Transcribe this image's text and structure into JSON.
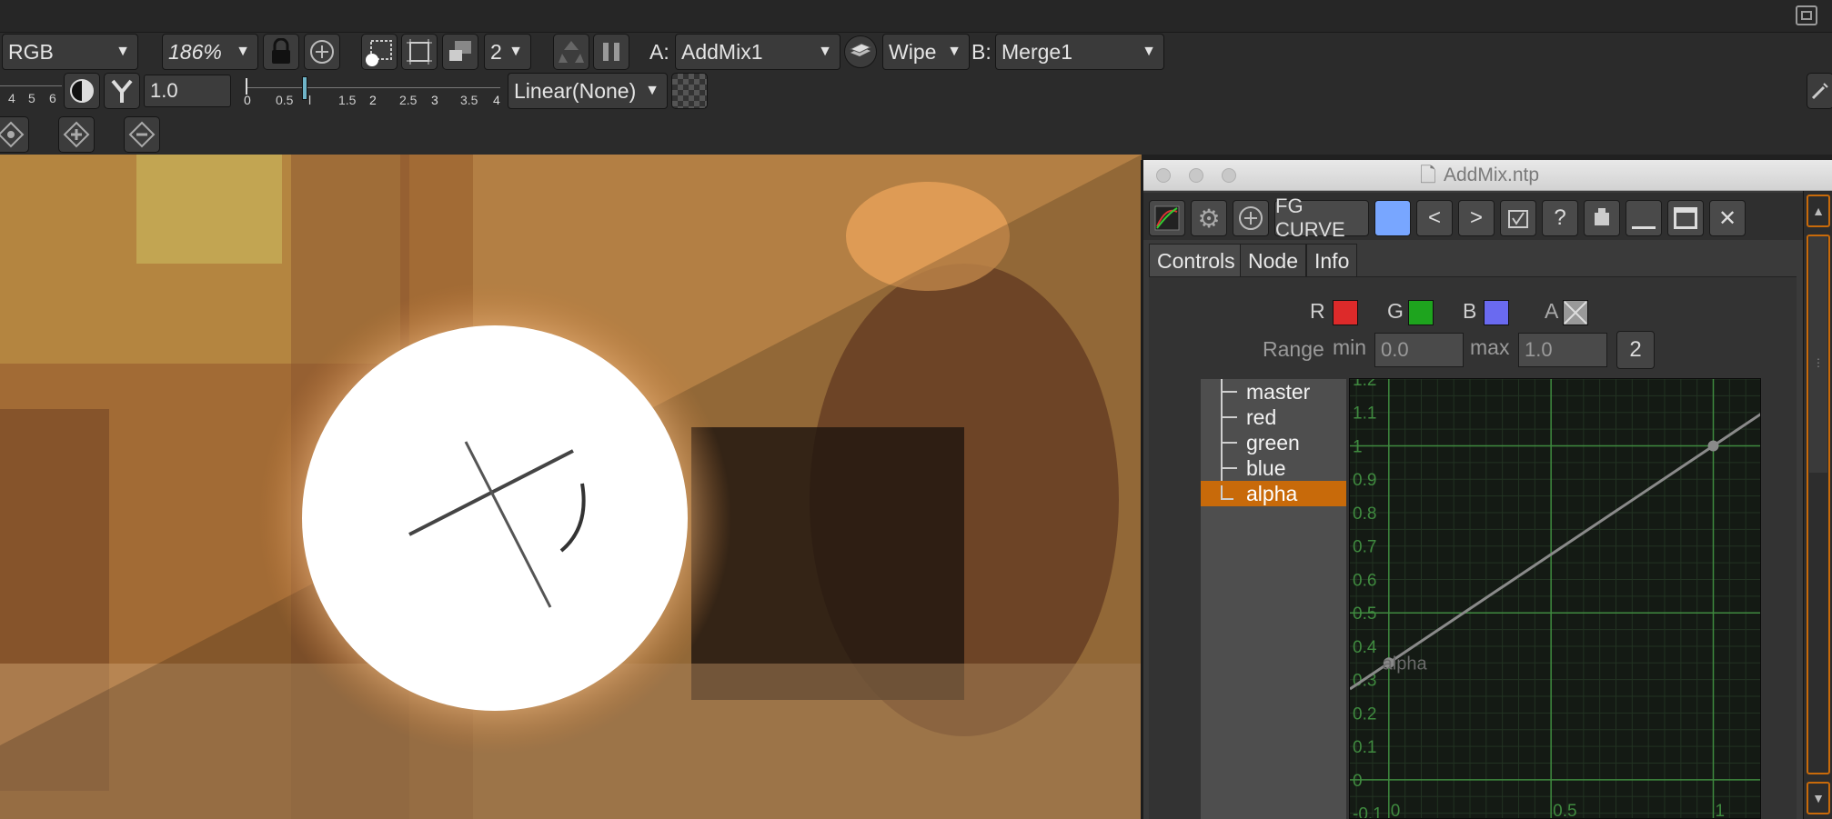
{
  "toolbar": {
    "channel": "RGB",
    "zoom": "186%",
    "downrez": "2",
    "a_label": "A:",
    "a_input": "AddMix1",
    "wipe_mode": "Wipe",
    "b_label": "B:",
    "b_input": "Merge1",
    "gain_value": "1.0",
    "colorspace": "Linear(None)",
    "fstops": [
      "4",
      "5",
      "6"
    ],
    "gamma_ticks": [
      "0",
      "0.5",
      "l",
      "1.5",
      "2",
      "2.5",
      "3",
      "3.5",
      "4"
    ]
  },
  "panel": {
    "title": "AddMix.ntp",
    "curve_name": "FG CURVE",
    "tabs": [
      "Controls",
      "Node",
      "Info"
    ],
    "channels": {
      "r": "R",
      "g": "G",
      "b": "B",
      "a": "A"
    },
    "range_label": "Range",
    "min_label": "min",
    "min_value": "0.0",
    "max_label": "max",
    "max_value": "1.0",
    "range_button": "2",
    "curve_list": [
      "master",
      "red",
      "green",
      "blue",
      "alpha"
    ],
    "selected_curve": "alpha"
  },
  "colors": {
    "red": "#dd2a2a",
    "green": "#1ea41e",
    "blue": "#6a6af0",
    "accent": "#c86a0a",
    "curve_swatch": "#78a6ff"
  },
  "chart_data": {
    "type": "line",
    "title": "",
    "xlabel": "",
    "ylabel": "",
    "series": [
      {
        "name": "alpha",
        "x": [
          0,
          1
        ],
        "y": [
          0.35,
          1.0
        ]
      }
    ],
    "xlim": [
      -0.12,
      1.15
    ],
    "ylim": [
      -0.12,
      1.2
    ],
    "x_ticks": [
      "0",
      "0.5",
      "1"
    ],
    "y_ticks": [
      "-0.1",
      "0",
      "0.1",
      "0.2",
      "0.3",
      "0.4",
      "0.5",
      "0.6",
      "0.7",
      "0.8",
      "0.9",
      "1",
      "1.1",
      "1.2"
    ],
    "curve_label": "alpha",
    "grid": true
  }
}
